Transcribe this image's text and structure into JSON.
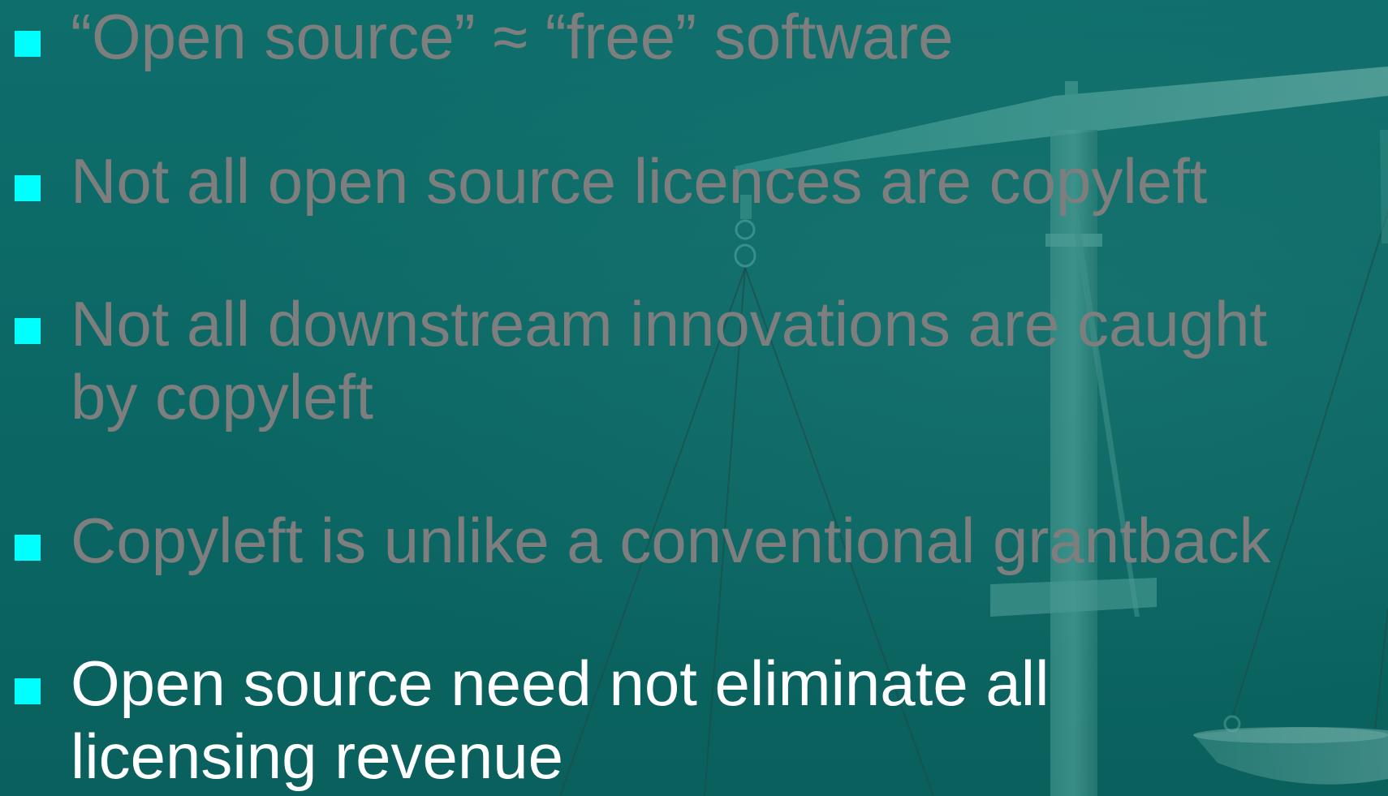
{
  "slide": {
    "background_color": "#0b6a67",
    "bullet_color": "#00ffff",
    "dimmed_text_color": "#7e7e7e",
    "active_text_color": "#ffffff",
    "decoration_icon": "scales-of-justice-icon",
    "bullets": [
      {
        "lines": [
          "“Open source” ≈ “free” software"
        ],
        "state": "dimmed"
      },
      {
        "lines": [
          "Not all open source licences are copyleft"
        ],
        "state": "dimmed"
      },
      {
        "lines": [
          "Not all downstream innovations are caught",
          "by copyleft"
        ],
        "state": "dimmed"
      },
      {
        "lines": [
          "Copyleft is unlike a conventional grantback"
        ],
        "state": "dimmed"
      },
      {
        "lines": [
          "Open source need not eliminate all",
          "licensing revenue"
        ],
        "state": "active"
      }
    ]
  }
}
